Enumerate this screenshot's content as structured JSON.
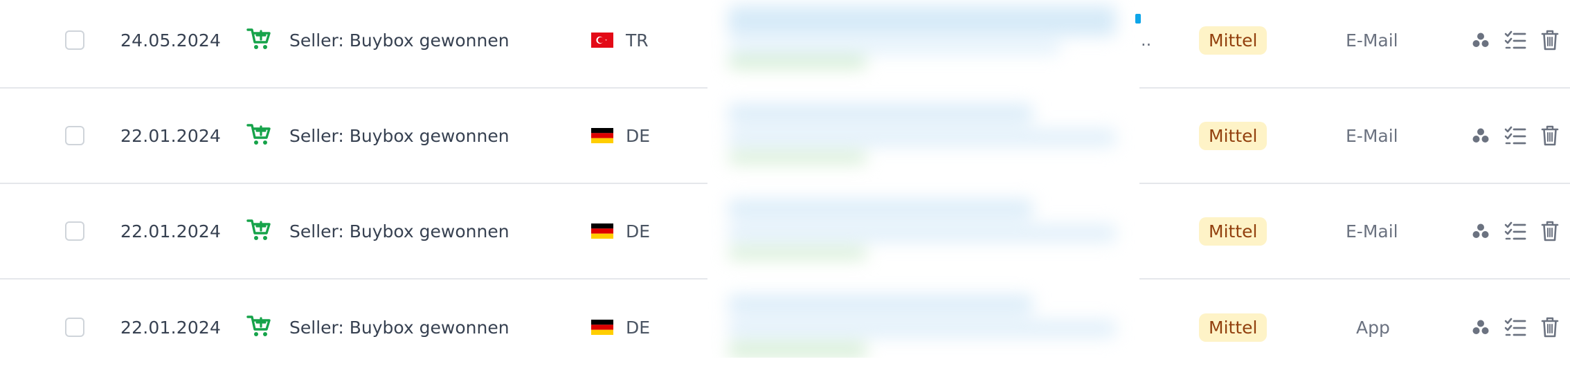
{
  "colors": {
    "icon_green": "#16a34a",
    "badge_bg": "#fef3c7",
    "badge_text": "#92400e",
    "action_icon": "#6b7280",
    "divider": "#e5e7eb"
  },
  "rows": [
    {
      "date": "24.05.2024",
      "type_icon": "cart-plus-icon",
      "type_label": "Seller: Buybox gewonnen",
      "country_code": "TR",
      "flag": "turkey-flag",
      "priority": "Mittel",
      "channel": "E-Mail"
    },
    {
      "date": "22.01.2024",
      "type_icon": "cart-plus-icon",
      "type_label": "Seller: Buybox gewonnen",
      "country_code": "DE",
      "flag": "germany-flag",
      "priority": "Mittel",
      "channel": "E-Mail"
    },
    {
      "date": "22.01.2024",
      "type_icon": "cart-plus-icon",
      "type_label": "Seller: Buybox gewonnen",
      "country_code": "DE",
      "flag": "germany-flag",
      "priority": "Mittel",
      "channel": "E-Mail"
    },
    {
      "date": "22.01.2024",
      "type_icon": "cart-plus-icon",
      "type_label": "Seller: Buybox gewonnen",
      "country_code": "DE",
      "flag": "germany-flag",
      "priority": "Mittel",
      "channel": "App"
    }
  ],
  "actions": [
    "group-icon",
    "checklist-icon",
    "trash-icon"
  ],
  "truncation": ".."
}
